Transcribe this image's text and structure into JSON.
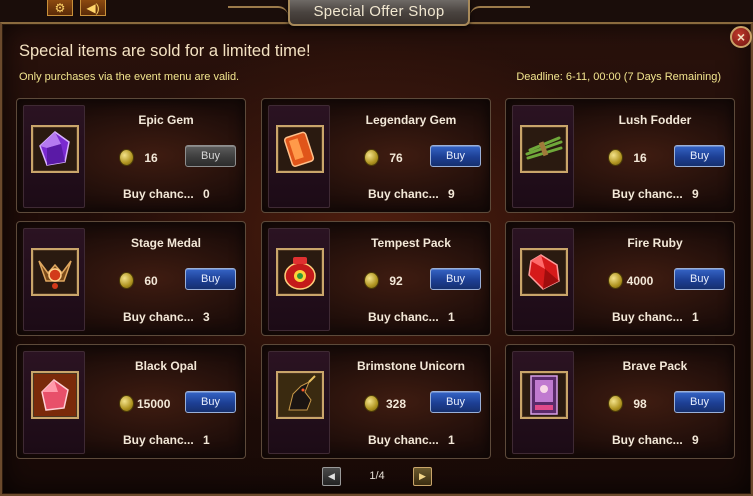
{
  "window": {
    "title": "Special Offer Shop",
    "close_label": "×"
  },
  "top_icons": {
    "gear": "gear-icon",
    "sound": "speaker-icon"
  },
  "header": {
    "headline": "Special items are sold for a limited time!",
    "note": "Only purchases via the event menu are valid.",
    "deadline": "Deadline: 6-11, 00:00 (7 Days Remaining)"
  },
  "items": [
    {
      "name": "Epic Gem",
      "price": "16",
      "buy_label": "Buy",
      "buy_enabled": false,
      "chance_label": "Buy chanc...",
      "chance_value": "0",
      "icon": "purple-gem-icon"
    },
    {
      "name": "Legendary Gem",
      "price": "76",
      "buy_label": "Buy",
      "buy_enabled": true,
      "chance_label": "Buy chanc...",
      "chance_value": "9",
      "icon": "orange-gem-icon"
    },
    {
      "name": "Lush Fodder",
      "price": "16",
      "buy_label": "Buy",
      "buy_enabled": true,
      "chance_label": "Buy chanc...",
      "chance_value": "9",
      "icon": "grass-bundle-icon"
    },
    {
      "name": "Stage Medal",
      "price": "60",
      "buy_label": "Buy",
      "buy_enabled": true,
      "chance_label": "Buy chanc...",
      "chance_value": "3",
      "icon": "medal-icon"
    },
    {
      "name": "Tempest Pack",
      "price": "92",
      "buy_label": "Buy",
      "buy_enabled": true,
      "chance_label": "Buy chanc...",
      "chance_value": "1",
      "icon": "red-pouch-icon"
    },
    {
      "name": "Fire Ruby",
      "price": "4000",
      "buy_label": "Buy",
      "buy_enabled": true,
      "chance_label": "Buy chanc...",
      "chance_value": "1",
      "icon": "red-ruby-icon"
    },
    {
      "name": "Black Opal",
      "price": "15000",
      "buy_label": "Buy",
      "buy_enabled": true,
      "chance_label": "Buy chanc...",
      "chance_value": "1",
      "icon": "pink-opal-icon"
    },
    {
      "name": "Brimstone Unicorn",
      "price": "328",
      "buy_label": "Buy",
      "buy_enabled": true,
      "chance_label": "Buy chanc...",
      "chance_value": "1",
      "icon": "unicorn-icon"
    },
    {
      "name": "Brave Pack",
      "price": "98",
      "buy_label": "Buy",
      "buy_enabled": true,
      "chance_label": "Buy chanc...",
      "chance_value": "9",
      "icon": "card-pack-icon"
    }
  ],
  "pagination": {
    "prev_label": "◀",
    "next_label": "▶",
    "page": "1/4"
  },
  "colors": {
    "buy_button": "#1d3f94",
    "buy_button_disabled": "#3e3e3e",
    "note_text": "#f2e58e",
    "slot_border": "#c9a56a"
  }
}
